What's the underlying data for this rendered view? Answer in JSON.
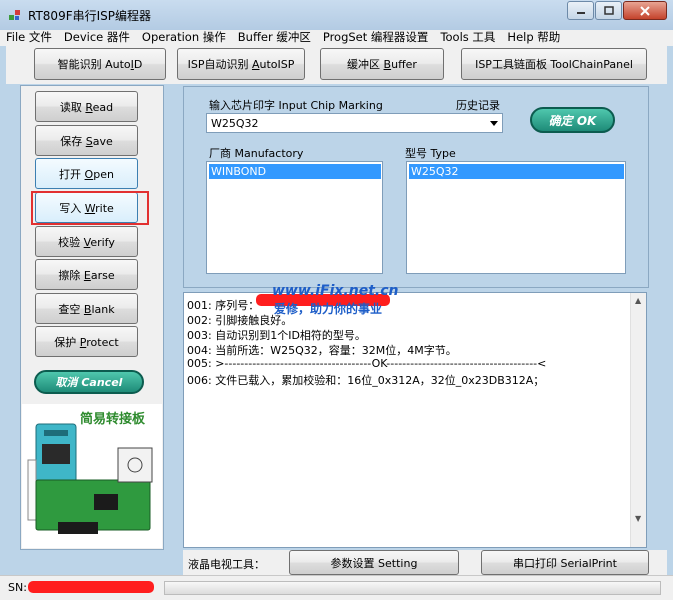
{
  "window": {
    "title": "RT809F串行ISP编程器"
  },
  "menu": [
    {
      "label": "File 文件"
    },
    {
      "label": "Device 器件"
    },
    {
      "label": "Operation 操作"
    },
    {
      "label": "Buffer 缓冲区"
    },
    {
      "label": "ProgSet 编程器设置"
    },
    {
      "label": "Tools 工具"
    },
    {
      "label": "Help 帮助"
    }
  ],
  "toolbar": {
    "auto_id": {
      "pre": "智能识别 Auto",
      "key": "I",
      "post": "D"
    },
    "isp_auto": {
      "pre": "ISP自动识别 ",
      "key": "A",
      "post": "utoISP"
    },
    "buffer": {
      "pre": "缓冲区 ",
      "key": "B",
      "post": "uffer"
    },
    "toolchain": {
      "label": "ISP工具链面板  ToolChainPanel"
    }
  },
  "side_buttons": [
    {
      "pre": "读取 ",
      "key": "R",
      "post": "ead"
    },
    {
      "pre": "保存 ",
      "key": "S",
      "post": "ave"
    },
    {
      "pre": "打开 ",
      "key": "O",
      "post": "pen"
    },
    {
      "pre": "写入 ",
      "key": "W",
      "post": "rite"
    },
    {
      "pre": "校验 ",
      "key": "V",
      "post": "erify"
    },
    {
      "pre": "擦除 ",
      "key": "E",
      "post": "arse"
    },
    {
      "pre": "查空 ",
      "key": "B",
      "post": "lank"
    },
    {
      "pre": "保护 ",
      "key": "P",
      "post": "rotect"
    }
  ],
  "chip": {
    "marking_label": "输入芯片印字 Input Chip Marking",
    "history_label": "历史记录",
    "value": "W25Q32",
    "ok_label": "确定 OK",
    "manufactory_label": "厂商 Manufactory",
    "manufactory_selected": "WINBOND",
    "type_label": "型号 Type",
    "type_selected": "W25Q32"
  },
  "cancel_label": "取消 Cancel",
  "log": [
    "001: 序列号：",
    "002: 引脚接触良好。",
    "003: 自动识别到1个ID相符的型号。",
    "004: 当前所选：W25Q32，容量：32M位，4M字节。",
    "005: >-------------------------------------OK--------------------------------------<",
    "006: 文件已载入，累加校验和：16位_0x312A，32位_0x23DB312A；"
  ],
  "watermark": {
    "url": "www.iFix.net.cn",
    "slogan": "爱修，助力你的事业"
  },
  "adapter": {
    "title": "简易转接板"
  },
  "bottom": {
    "lcd_label": "液晶电视工具：",
    "setting": "参数设置  Setting",
    "serial": "串口打印  SerialPrint"
  },
  "status": {
    "sn_label": "SN:"
  },
  "colors": {
    "accent": "#3399ff",
    "highlight": "#e23030",
    "ok_button": "#1e8b78"
  }
}
